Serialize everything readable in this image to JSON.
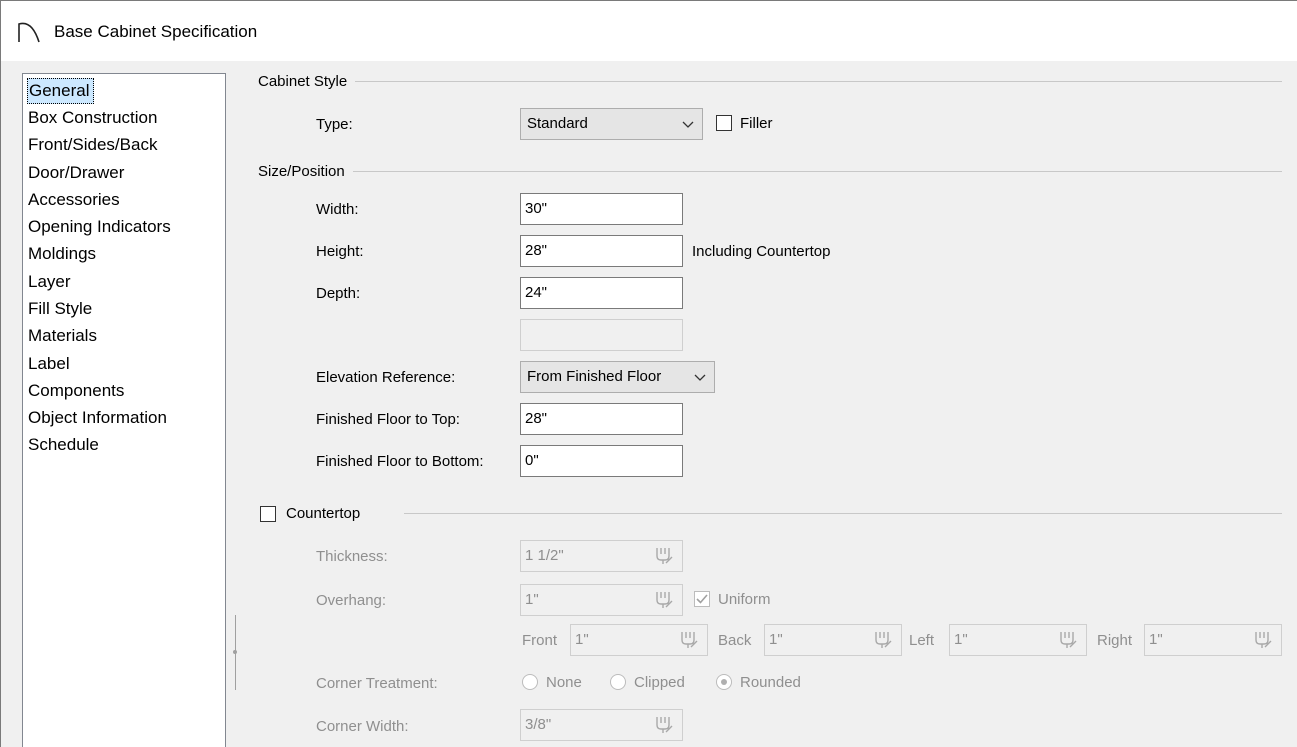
{
  "window": {
    "title": "Base Cabinet Specification",
    "icon": "arc-cabinet-icon"
  },
  "nav": {
    "items": [
      {
        "label": "General",
        "selected": true
      },
      {
        "label": "Box Construction"
      },
      {
        "label": "Front/Sides/Back"
      },
      {
        "label": "Door/Drawer"
      },
      {
        "label": "Accessories"
      },
      {
        "label": "Opening Indicators"
      },
      {
        "label": "Moldings"
      },
      {
        "label": "Layer"
      },
      {
        "label": "Fill Style"
      },
      {
        "label": "Materials"
      },
      {
        "label": "Label"
      },
      {
        "label": "Components"
      },
      {
        "label": "Object Information"
      },
      {
        "label": "Schedule"
      }
    ]
  },
  "cabinet_style": {
    "group_label": "Cabinet Style",
    "type_label": "Type:",
    "type_value": "Standard",
    "filler_label": "Filler",
    "filler_checked": false
  },
  "size_position": {
    "group_label": "Size/Position",
    "width_label": "Width:",
    "width_value": "30\"",
    "height_label": "Height:",
    "height_value": "28\"",
    "height_note": "Including Countertop",
    "depth_label": "Depth:",
    "depth_value": "24\"",
    "blank_value": "",
    "elevation_ref_label": "Elevation Reference:",
    "elevation_ref_value": "From Finished Floor",
    "floor_to_top_label": "Finished Floor to Top:",
    "floor_to_top_value": "28\"",
    "floor_to_bottom_label": "Finished Floor to Bottom:",
    "floor_to_bottom_value": "0\""
  },
  "countertop": {
    "group_label": "Countertop",
    "checked": false,
    "thickness_label": "Thickness:",
    "thickness_value": "1 1/2\"",
    "overhang_label": "Overhang:",
    "overhang_value": "1\"",
    "uniform_label": "Uniform",
    "uniform_checked": true,
    "front_label": "Front",
    "front_value": "1\"",
    "back_label": "Back",
    "back_value": "1\"",
    "left_label": "Left",
    "left_value": "1\"",
    "right_label": "Right",
    "right_value": "1\"",
    "corner_treatment_label": "Corner Treatment:",
    "corner_options": [
      "None",
      "Clipped",
      "Rounded"
    ],
    "corner_selected": "Rounded",
    "corner_width_label": "Corner Width:",
    "corner_width_value": "3/8\""
  },
  "colors": {
    "selection": "#cce8ff",
    "disabled_text": "#8f8f8f",
    "dialog_bg": "#f0f0f0"
  }
}
